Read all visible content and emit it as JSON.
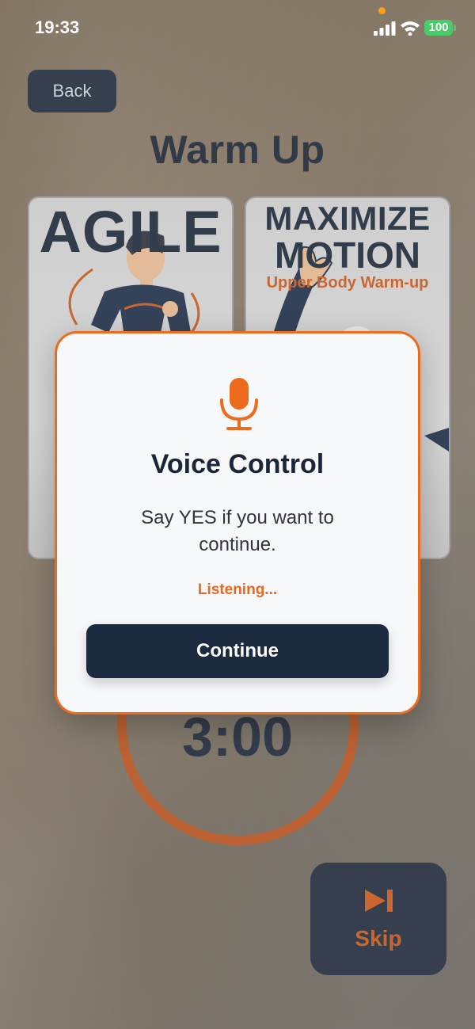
{
  "status_bar": {
    "time": "19:33",
    "battery": "100"
  },
  "header": {
    "back_label": "Back",
    "title": "Warm Up"
  },
  "cards": [
    {
      "headline": "AGILE"
    },
    {
      "headline_line1": "MAXIMIZE",
      "headline_line2": "MOTION",
      "subtitle": "Upper Body Warm-up"
    }
  ],
  "timer": {
    "value": "3:00"
  },
  "skip": {
    "label": "Skip",
    "icon": "skip-forward-icon"
  },
  "modal": {
    "icon": "microphone-icon",
    "title": "Voice Control",
    "message": "Say YES if you want to continue.",
    "status": "Listening...",
    "continue_label": "Continue"
  },
  "colors": {
    "accent": "#ee6b1e",
    "navy": "#1c2a40",
    "battery": "#34c759"
  }
}
